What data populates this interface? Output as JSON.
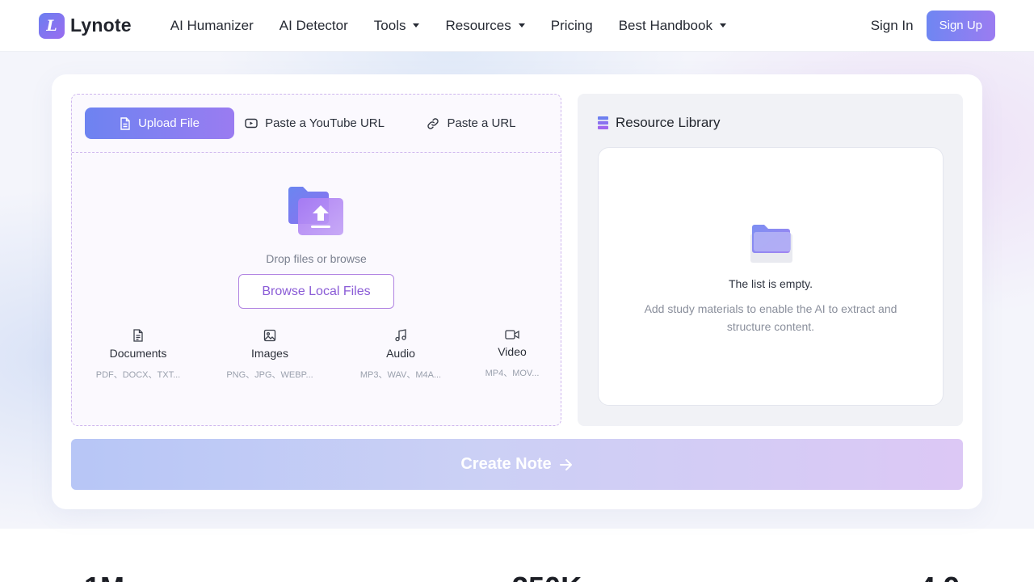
{
  "brand": {
    "name": "Lynote",
    "mark": "L",
    "accent_start": "#6d83f1",
    "accent_end": "#9a7cf1"
  },
  "nav": {
    "items": [
      {
        "label": "AI Humanizer",
        "has_dropdown": false
      },
      {
        "label": "AI Detector",
        "has_dropdown": false
      },
      {
        "label": "Tools",
        "has_dropdown": true
      },
      {
        "label": "Resources",
        "has_dropdown": true
      },
      {
        "label": "Pricing",
        "has_dropdown": false
      },
      {
        "label": "Best Handbook",
        "has_dropdown": true
      }
    ],
    "sign_in": "Sign In",
    "sign_up": "Sign Up"
  },
  "upload": {
    "tabs": [
      {
        "label": "Upload File",
        "icon": "file-icon",
        "active": true
      },
      {
        "label": "Paste a YouTube URL",
        "icon": "youtube-icon",
        "active": false
      },
      {
        "label": "Paste a URL",
        "icon": "link-icon",
        "active": false
      }
    ],
    "drop_hint": "Drop files or browse",
    "browse_label": "Browse Local Files",
    "file_types": [
      {
        "name": "Documents",
        "extensions": "PDF、DOCX、TXT...",
        "icon": "document-icon"
      },
      {
        "name": "Images",
        "extensions": "PNG、JPG、WEBP...",
        "icon": "image-icon"
      },
      {
        "name": "Audio",
        "extensions": "MP3、WAV、M4A...",
        "icon": "music-icon"
      },
      {
        "name": "Video",
        "extensions": "MP4、MOV...",
        "icon": "video-icon"
      }
    ]
  },
  "library": {
    "title": "Resource Library",
    "icon": "library-icon",
    "empty_title": "The list is empty.",
    "empty_description": "Add study materials to enable the AI to extract and structure content."
  },
  "create": {
    "label": "Create Note"
  },
  "stats_peek": [
    "1M",
    "350K",
    "4.9"
  ]
}
